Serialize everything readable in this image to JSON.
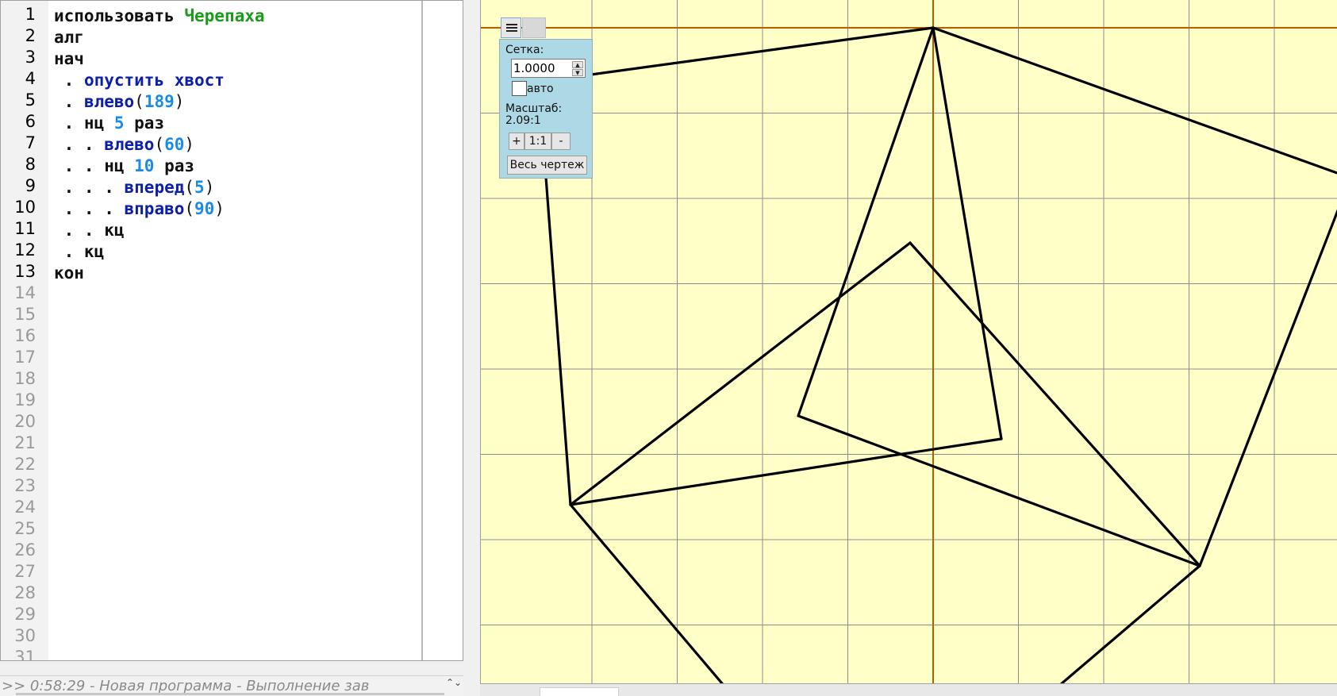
{
  "editor": {
    "line_numbers": [
      "1",
      "2",
      "3",
      "4",
      "5",
      "6",
      "7",
      "8",
      "9",
      "10",
      "11",
      "12",
      "13",
      "14",
      "15",
      "16",
      "17",
      "18",
      "19",
      "20",
      "21",
      "22",
      "23",
      "24",
      "25",
      "26",
      "27",
      "28",
      "29",
      "30",
      "31"
    ],
    "lines": [
      [
        {
          "t": "использовать ",
          "c": "kw"
        },
        {
          "t": "Черепаха",
          "c": "mod"
        }
      ],
      [
        {
          "t": "алг",
          "c": "kw"
        }
      ],
      [
        {
          "t": "нач",
          "c": "kw"
        }
      ],
      [
        {
          "t": " . ",
          "c": "kw"
        },
        {
          "t": "опустить хвост",
          "c": "cmd"
        }
      ],
      [
        {
          "t": " . ",
          "c": "kw"
        },
        {
          "t": "влево",
          "c": "cmd"
        },
        {
          "t": "(",
          "c": "plain"
        },
        {
          "t": "189",
          "c": "num"
        },
        {
          "t": ")",
          "c": "plain"
        }
      ],
      [
        {
          "t": " . нц ",
          "c": "kw"
        },
        {
          "t": "5",
          "c": "num"
        },
        {
          "t": " раз",
          "c": "kw"
        }
      ],
      [
        {
          "t": " . . ",
          "c": "kw"
        },
        {
          "t": "влево",
          "c": "cmd"
        },
        {
          "t": "(",
          "c": "plain"
        },
        {
          "t": "60",
          "c": "num"
        },
        {
          "t": ")",
          "c": "plain"
        }
      ],
      [
        {
          "t": " . . нц ",
          "c": "kw"
        },
        {
          "t": "10",
          "c": "num"
        },
        {
          "t": " раз",
          "c": "kw"
        }
      ],
      [
        {
          "t": " . . . ",
          "c": "kw"
        },
        {
          "t": "вперед",
          "c": "cmd"
        },
        {
          "t": "(",
          "c": "plain"
        },
        {
          "t": "5",
          "c": "num"
        },
        {
          "t": ")",
          "c": "plain"
        }
      ],
      [
        {
          "t": " . . . ",
          "c": "kw"
        },
        {
          "t": "вправо",
          "c": "cmd"
        },
        {
          "t": "(",
          "c": "plain"
        },
        {
          "t": "90",
          "c": "num"
        },
        {
          "t": ")",
          "c": "plain"
        }
      ],
      [
        {
          "t": " . . кц",
          "c": "kw"
        }
      ],
      [
        {
          "t": " . кц",
          "c": "kw"
        }
      ],
      [
        {
          "t": "кон",
          "c": "kw"
        }
      ]
    ]
  },
  "status": {
    "text": ">>  0:58:29 - Новая программа - Выполнение зав",
    "scroll_glyph": "⌃⌄"
  },
  "panel": {
    "menu_icon": "hamburger-menu-icon",
    "grid_label": "Сетка:",
    "grid_value": "1.0000",
    "spin_up": "▲",
    "spin_down": "▼",
    "auto_label": "авто",
    "auto_checked": false,
    "scale_label": "Масштаб:",
    "scale_value": "2.09:1",
    "zoom_in": "+",
    "zoom_reset": "1:1",
    "zoom_out": "-",
    "fit_all": "Весь чертеж"
  },
  "colors": {
    "canvas_bg": "#ffffc8",
    "grid": "#8c8c8c",
    "axis": "#b85c00",
    "path": "#000000",
    "panel_bg": "#add8e6"
  }
}
